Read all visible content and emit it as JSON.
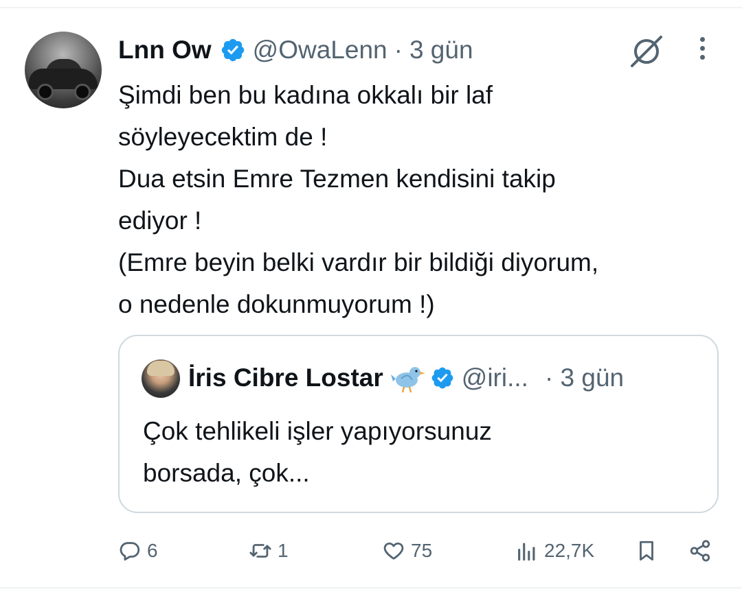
{
  "tweet": {
    "author_name": "Lnn Ow",
    "handle": "@OwaLenn",
    "separator": "·",
    "time": "3 gün",
    "text_lines": [
      "Şimdi ben bu kadına okkalı bir laf",
      "söyleyecektim de !",
      "Dua etsin Emre Tezmen kendisini takip",
      "ediyor !",
      "(Emre beyin belki vardır bir bildiği diyorum,",
      "o nedenle dokunmuyorum !)"
    ]
  },
  "quoted_tweet": {
    "author_name": "İris Cibre Lostar",
    "handle": "@iri...",
    "time": "· 3 gün",
    "text_lines": [
      "Çok tehlikeli işler yapıyorsunuz",
      "borsada, çok..."
    ]
  },
  "actions": {
    "replies": "6",
    "retweets": "1",
    "likes": "75",
    "views": "22,7K"
  },
  "icons": {
    "verified": "verified-badge-icon",
    "bird": "bird-emoji-icon",
    "grok": "grok-icon",
    "more": "more-options-icon",
    "reply": "reply-icon",
    "retweet": "retweet-icon",
    "like": "heart-icon",
    "views": "views-chart-icon",
    "bookmark": "bookmark-icon",
    "share": "share-icon"
  },
  "colors": {
    "text": "#0f1419",
    "secondary": "#536471",
    "verified_blue": "#1d9bf0",
    "border": "#cfd9de"
  }
}
